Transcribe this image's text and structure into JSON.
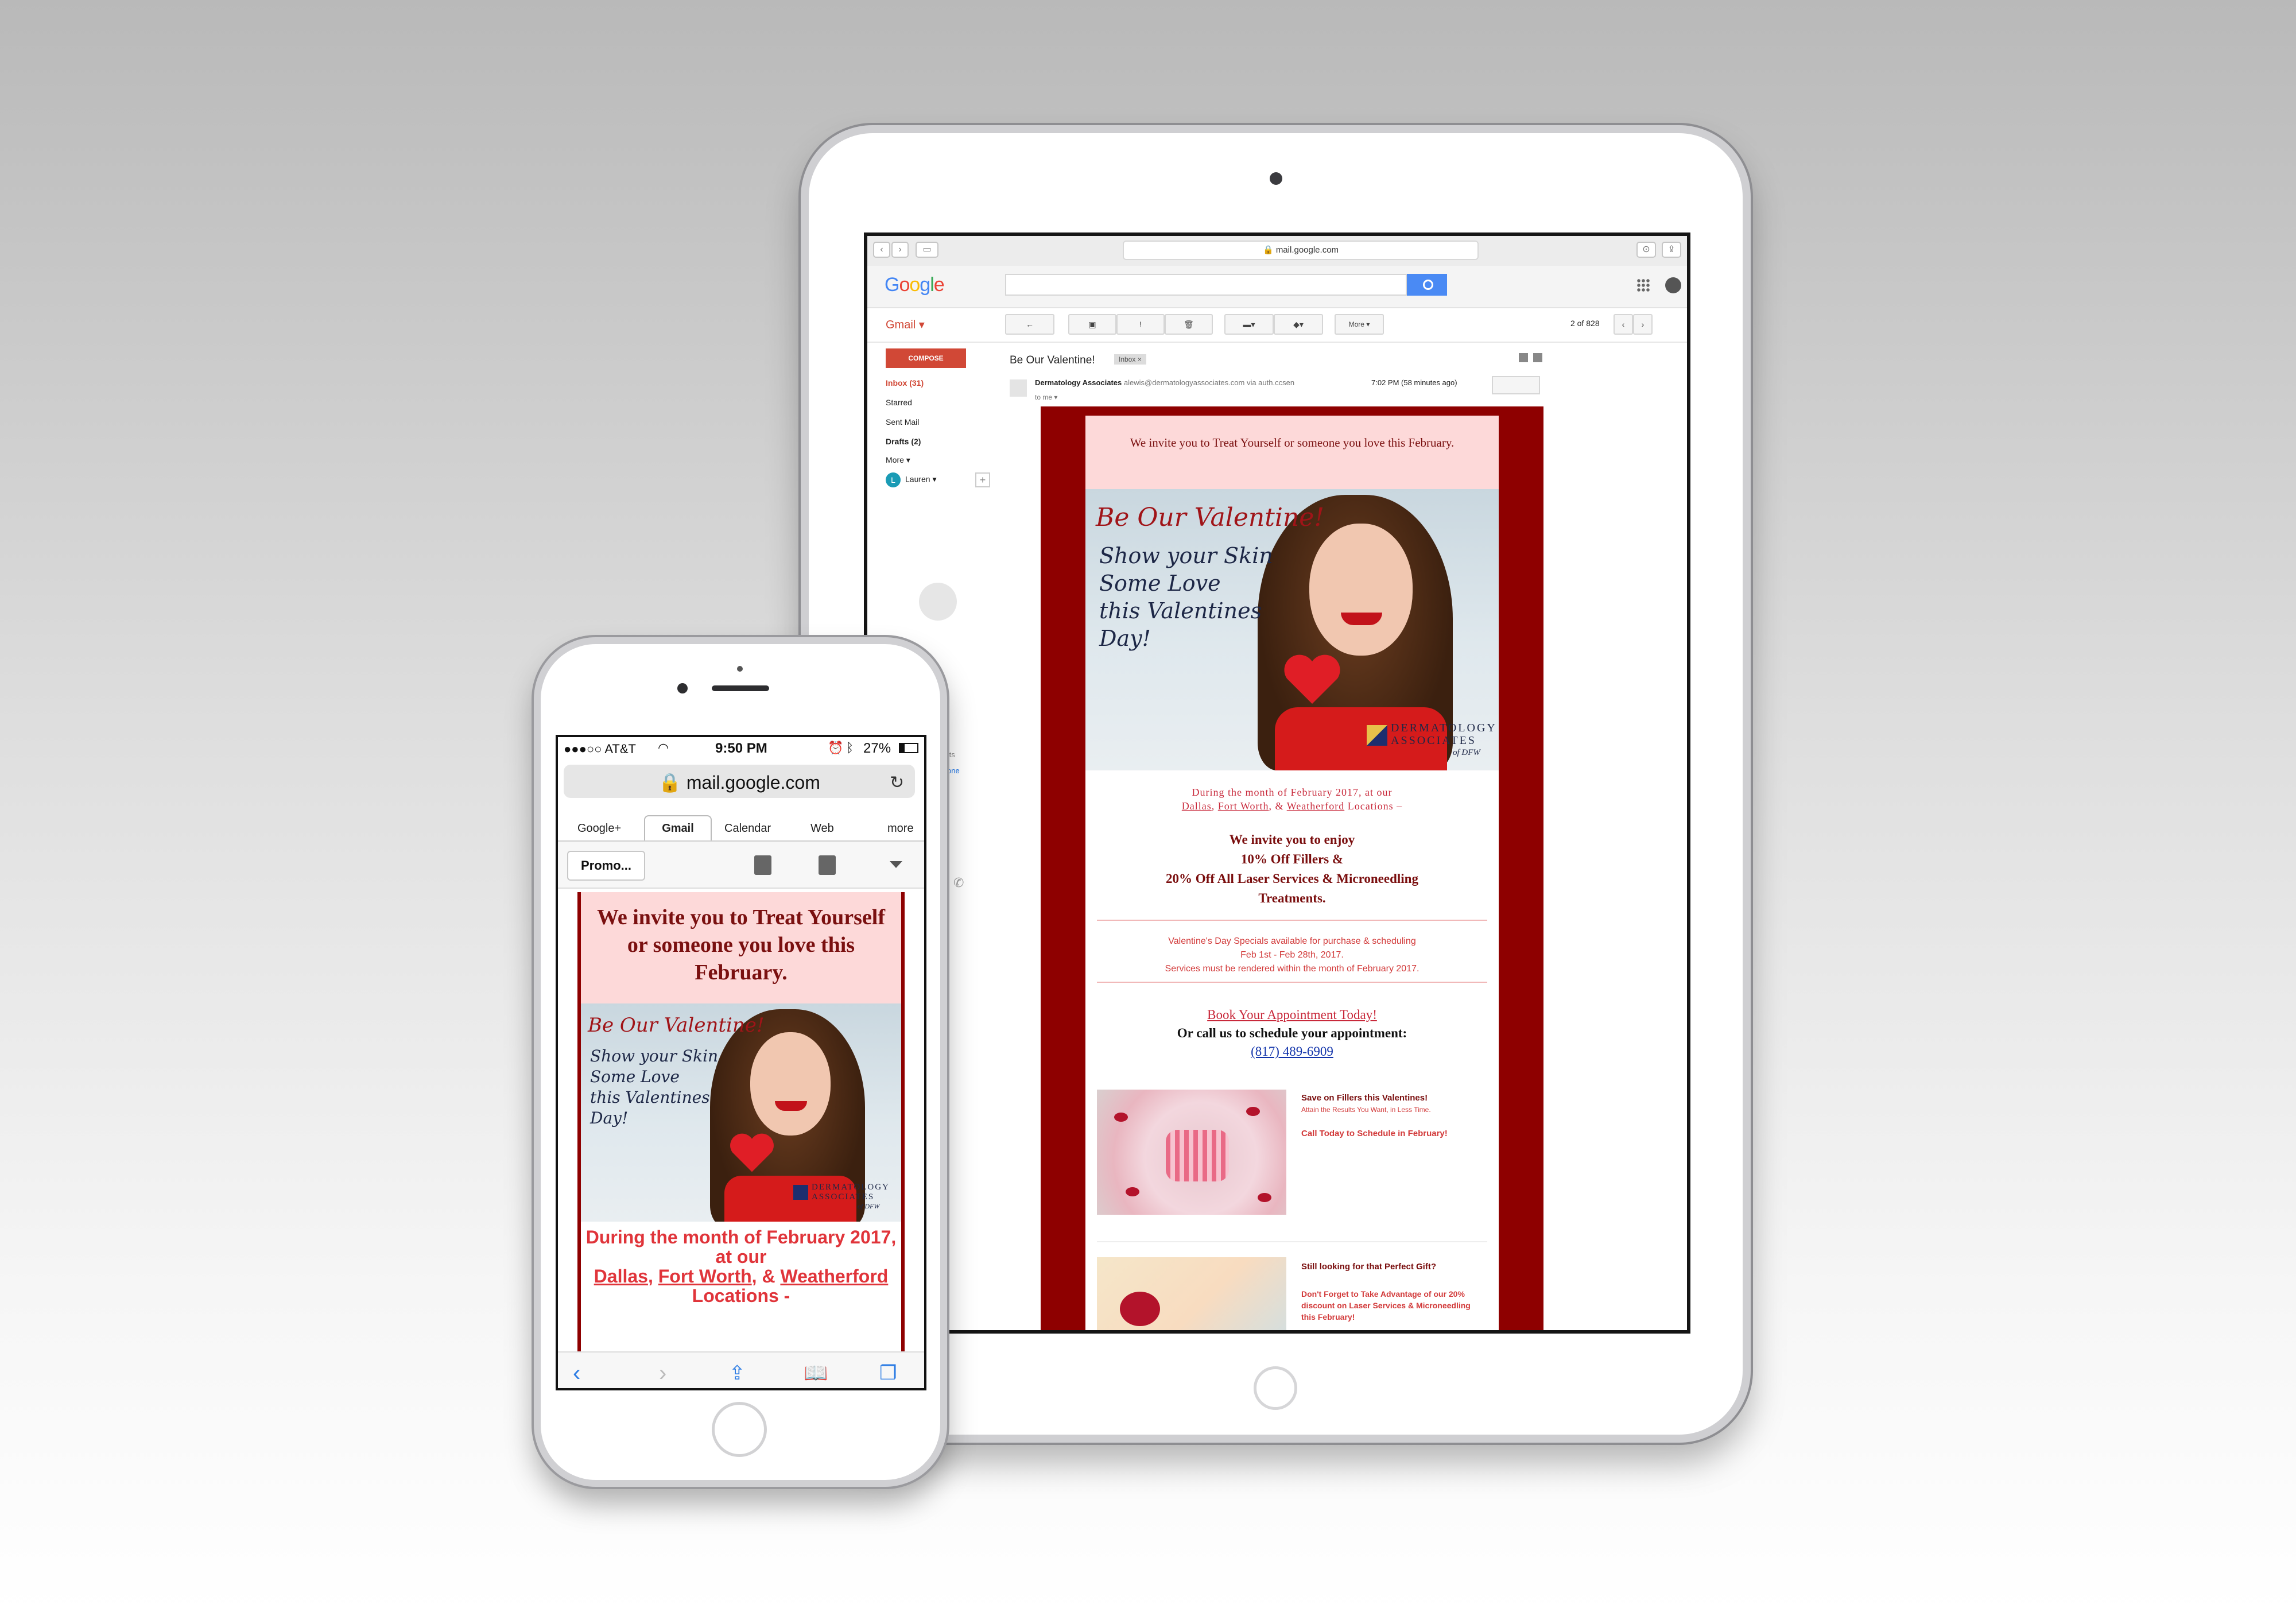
{
  "ipad": {
    "safari": {
      "url": "mail.google.com"
    },
    "gmail": {
      "logo": "Google",
      "app_label": "Gmail ▾",
      "more_label": "More ▾",
      "pager": "2 of 828",
      "compose": "COMPOSE",
      "nav": [
        "Inbox (31)",
        "Starred",
        "Sent Mail",
        "Drafts (2)",
        "More ▾"
      ],
      "user": {
        "initial": "L",
        "name": "Lauren ▾"
      },
      "hangouts_text": "ent chats",
      "hangouts_link": "w one"
    },
    "message": {
      "subject": "Be Our Valentine!",
      "tag": "Inbox ×",
      "sender_name": "Dermatology Associates",
      "sender_email": "alewis@dermatologyassociates.com",
      "via": "via auth.ccsen",
      "to": "to me ▾",
      "time": "7:02 PM (58 minutes ago)"
    },
    "email": {
      "invite": "We invite you to Treat Yourself or someone you love this February.",
      "hero_title": "Be Our Valentine!",
      "hero_lines": [
        "Show your Skin",
        "Some Love",
        "this Valentines",
        "Day!"
      ],
      "logo": {
        "line1": "DERMATOLOGY",
        "line2": "ASSOCIATES",
        "line3": "of DFW"
      },
      "during_prefix": "During the month of February 2017, at our",
      "locations": [
        "Dallas",
        "Fort Worth",
        "Weatherford"
      ],
      "during_suffix": "Locations –",
      "offer": [
        "We invite you to enjoy",
        "10% Off Fillers &",
        "20% Off All Laser Services & Microneedling",
        "Treatments."
      ],
      "specials": [
        "Valentine's Day Specials available for purchase & scheduling",
        "Feb 1st - Feb 28th, 2017.",
        "Services must be rendered within the month of February 2017."
      ],
      "book_link": "Book Your Appointment Today!",
      "call_text": "Or call us to schedule your appointment:",
      "phone": "(817) 489-6909",
      "promo1": {
        "headline": "Save on Fillers this Valentines!",
        "sub": "Attain the Results You Want, in Less Time.",
        "cta": "Call Today to Schedule in February!"
      },
      "promo2": {
        "headline": "Still looking for that Perfect Gift?",
        "sub": "Don't Forget to Take Advantage of our 20% discount on Laser Services & Microneedling this February!"
      }
    }
  },
  "iphone": {
    "status": {
      "carrier": "●●●○○ AT&T",
      "time": "9:50 PM",
      "battery": "27%"
    },
    "url": "mail.google.com",
    "tabs": [
      "Google+",
      "Gmail",
      "Calendar",
      "Web",
      "more"
    ],
    "folder_button": "Promo...",
    "email": {
      "invite": "We invite you to Treat Yourself or someone you love this February.",
      "during_prefix": "During the month of February 2017, at our",
      "locations": [
        "Dallas",
        "Fort Worth",
        "Weatherford"
      ],
      "during_suffix": "Locations -"
    }
  }
}
